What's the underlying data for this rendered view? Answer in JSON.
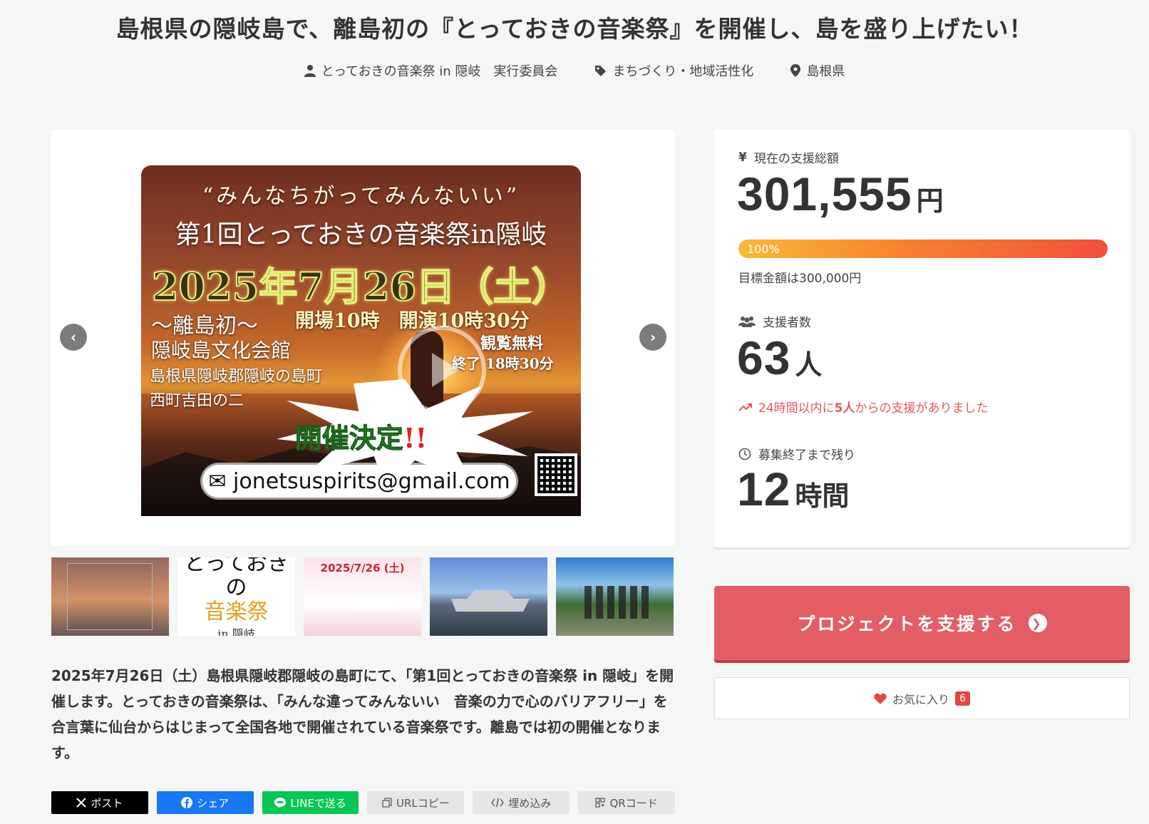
{
  "project": {
    "title": "島根県の隠岐島で、離島初の『とっておきの音楽祭』を開催し、島を盛り上げたい！",
    "owner": "とっておきの音楽祭 in 隠岐　実行委員会",
    "category": "まちづくり・地域活性化",
    "location": "島根県"
  },
  "poster": {
    "line1": "“みんなちがってみんないい”",
    "line2": "第1回とっておきの音楽祭in隠岐",
    "date": "2025年7月26日（土）",
    "sub_left": "～離島初～",
    "open_time": "開場10時　開演10時30分",
    "venue": "隠岐島文化会館",
    "address1": "島根県隠岐郡隠岐の島町",
    "address2": "西町吉田の二",
    "free": "観覧無料",
    "end_time": "終了 18時30分",
    "burst": "開催決定",
    "burst_ex": "!!",
    "email": "✉ jonetsuspirits@gmail.com"
  },
  "thumbnails": {
    "t2_line1": "とっておきの",
    "t2_line2": "音楽祭",
    "t2_line3": "in 隠岐",
    "t3_date": "2025/7/26 (土)"
  },
  "description": "2025年7月26日（土）島根県隠岐郡隠岐の島町にて、「第1回とっておきの音楽祭 in 隠岐」を開催します。とっておきの音楽祭は、「みんな違ってみんないい　音楽の力で心のバリアフリー」を合言葉に仙台からはじまって全国各地で開催されている音楽祭です。離島では初の開催となります。",
  "share": {
    "x": "ポスト",
    "facebook": "シェア",
    "line": "LINEで送る",
    "url": "URLコピー",
    "embed": "埋め込み",
    "qr": "QRコード"
  },
  "stats": {
    "amount_label": "現在の支援総額",
    "amount": "301,555",
    "amount_unit": "円",
    "progress_percent": 100,
    "progress_label": "100%",
    "goal": "目標金額は300,000円",
    "supporters_label": "支援者数",
    "supporters": "63",
    "supporters_unit": "人",
    "recent_prefix": "24時間以内に",
    "recent_count": "5人",
    "recent_suffix": "からの支援がありました",
    "remaining_label": "募集終了まで残り",
    "remaining": "12",
    "remaining_unit": "時間"
  },
  "actions": {
    "support_button": "プロジェクトを支援する",
    "favorite_label": "お気に入り",
    "favorite_count": "6"
  },
  "colors": {
    "cta": "#e35d64",
    "progress_start": "#f8b83a",
    "progress_end": "#f0503c",
    "recent_text": "#e05a58"
  }
}
